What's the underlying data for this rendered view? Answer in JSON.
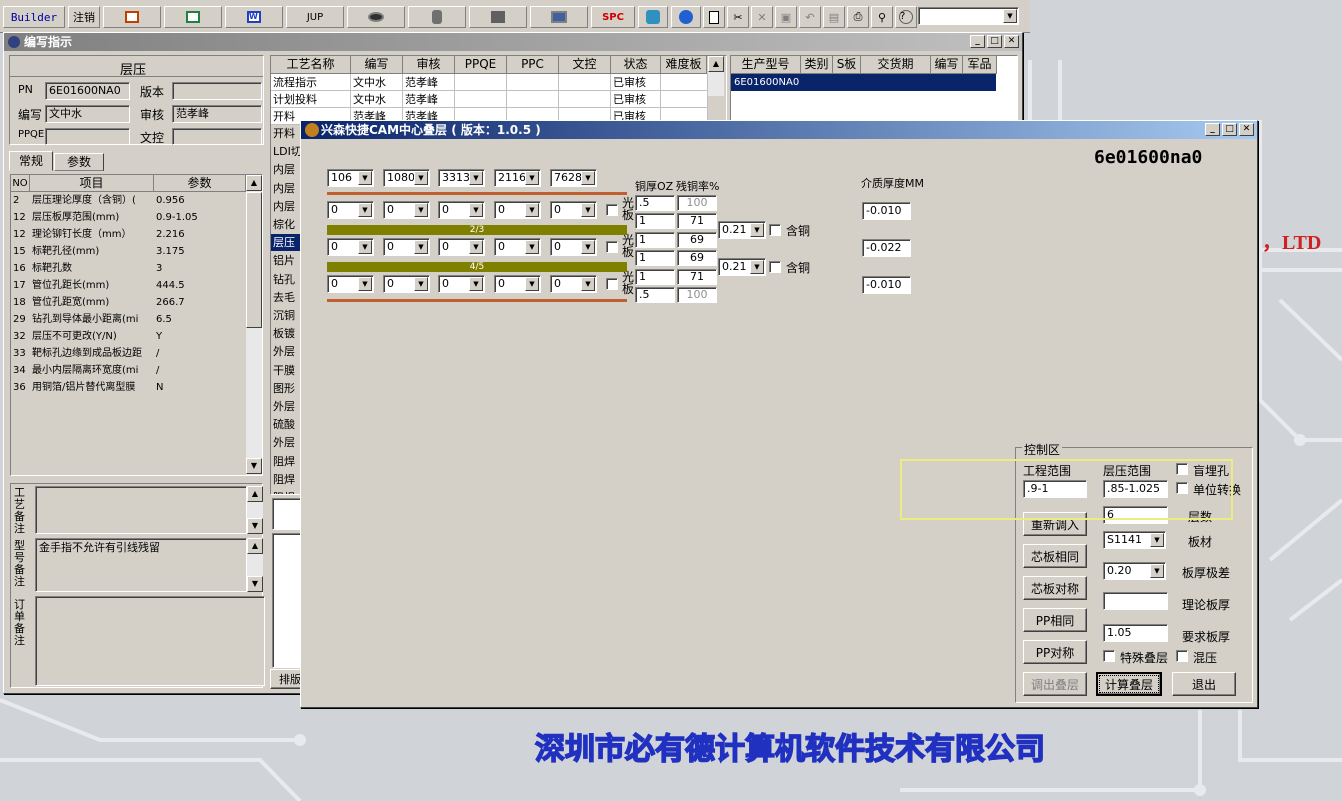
{
  "toolbar": {
    "builder": "Builder",
    "logout": "注销",
    "jup": "JUP",
    "spc": "SPC",
    "icons": [
      "excel-red-icon",
      "excel-green-icon",
      "word-icon",
      "eye-icon",
      "database-icon",
      "tools-icon",
      "monitor-icon",
      "refresh-icon",
      "ie-icon",
      "new-file-icon",
      "cut-icon",
      "close-x-icon",
      "save-icon",
      "undo-icon",
      "preview-icon",
      "print-icon",
      "find-icon",
      "help-icon"
    ]
  },
  "background": {
    "company_cn": "深圳市必有德计算机软件技术有限公司",
    "ltd": "，LTD"
  },
  "main_window": {
    "title": "编写指示",
    "section_title": "层压",
    "pn_label": "PN",
    "pn_value": "6E01600NA0",
    "version_label": "版本",
    "version_value": "",
    "writer_label": "编写",
    "writer_value": "文中水",
    "reviewer_label": "审核",
    "reviewer_value": "范孝峰",
    "ppqe_label": "PPQE",
    "ppqe_value": "",
    "doc_label": "文控",
    "doc_value": "",
    "tabs": [
      "常规",
      "参数"
    ],
    "param_headers": [
      "NO",
      "项目",
      "参数"
    ],
    "params": [
      {
        "no": "2",
        "item": "层压理论厚度（含铜）(",
        "val": "0.956"
      },
      {
        "no": "12",
        "item": "层压板厚范围(mm)",
        "val": "0.9-1.05"
      },
      {
        "no": "12",
        "item": "理论铆钉长度（mm）",
        "val": "2.216"
      },
      {
        "no": "15",
        "item": "标靶孔径(mm)",
        "val": "3.175"
      },
      {
        "no": "16",
        "item": "标靶孔数",
        "val": "3"
      },
      {
        "no": "17",
        "item": "管位孔距长(mm)",
        "val": "444.5"
      },
      {
        "no": "18",
        "item": "管位孔距宽(mm)",
        "val": "266.7"
      },
      {
        "no": "29",
        "item": "钻孔到导体最小距离(mi",
        "val": "6.5"
      },
      {
        "no": "32",
        "item": "层压不可更改(Y/N)",
        "val": "Y"
      },
      {
        "no": "33",
        "item": "靶标孔边缘到成品板边距",
        "val": "/"
      },
      {
        "no": "34",
        "item": "最小内层隔离环宽度(mi",
        "val": "/"
      },
      {
        "no": "36",
        "item": "用铜箔/铝片替代离型膜",
        "val": "N"
      }
    ],
    "note1_label": "工艺备注",
    "note2_label": "型号备注",
    "note2_value": "金手指不允许有引线残留",
    "note3_label": "订单备注",
    "process_headers": [
      "工艺名称",
      "编写",
      "审核",
      "PPQE",
      "PPC",
      "文控",
      "状态",
      "难度板"
    ],
    "process_rows": [
      {
        "name": "流程指示",
        "w": "文中水",
        "r": "范孝峰",
        "s": "已审核"
      },
      {
        "name": "计划投料",
        "w": "文中水",
        "r": "范孝峰",
        "s": "已审核"
      },
      {
        "name": "开料",
        "w": "范孝峰",
        "r": "范孝峰",
        "s": "已审核"
      }
    ],
    "process_names_side": [
      "开料",
      "LDI切",
      "内层",
      "内层",
      "内层",
      "棕化",
      "层压",
      "铝片",
      "钻孔",
      "去毛",
      "沉铜",
      "板镀",
      "外层",
      "干膜",
      "图形",
      "外层",
      "硫酸",
      "外层",
      "阻焊",
      "阻焊",
      "阻焊"
    ],
    "paiban": "排版",
    "model_headers": [
      "生产型号",
      "类别",
      "S板",
      "交货期",
      "编写",
      "军品"
    ],
    "model_row": "6E01600NA0"
  },
  "dialog": {
    "title": "兴森快捷CAM中心叠层 ( 版本：1.0.5 )",
    "model": "6e01600na0",
    "top_combos": [
      "106",
      "1080",
      "3313",
      "2116",
      "7628"
    ],
    "cu_thick_label": "铜厚OZ",
    "residual_label": "残铜率%",
    "dielectric_label": "介质厚度MM",
    "row1": [
      "0",
      "0",
      "0",
      "0",
      "0"
    ],
    "row2": [
      "0",
      "0",
      "0",
      "0",
      "0"
    ],
    "row3": [
      "0",
      "0",
      "0",
      "0",
      "0"
    ],
    "core_labels": [
      "2/3",
      "4/5"
    ],
    "guangban": "光板",
    "cu_values": [
      ".5",
      "1",
      "1",
      "1",
      "1",
      ".5"
    ],
    "res_values": [
      "100",
      "71",
      "69",
      "69",
      "71",
      "100"
    ],
    "core_thick": [
      "0.21",
      "0.21"
    ],
    "hantong": "含铜",
    "dielectrics": [
      "-0.010",
      "-0.022",
      "-0.010"
    ],
    "control_title": "控制区",
    "eng_range_label": "工程范围",
    "eng_range_value": ".9-1",
    "press_range_label": "层压范围",
    "press_range_value": ".85-1.025",
    "blind_label": "盲埋孔",
    "unit_label": "单位转换",
    "layers_label": "层数",
    "layers_value": "6",
    "material_label": "板材",
    "material_value": "S1141",
    "tolerance_label": "板厚极差",
    "tolerance_value": "0.20",
    "theory_label": "理论板厚",
    "theory_value": "",
    "required_label": "要求板厚",
    "required_value": "1.05",
    "special_label": "特殊叠层",
    "mixed_label": "混压",
    "btn_reload": "重新调入",
    "btn_core_same": "芯板相同",
    "btn_core_sym": "芯板对称",
    "btn_pp_same": "PP相同",
    "btn_pp_sym": "PP对称",
    "btn_export": "调出叠层",
    "btn_calc": "计算叠层",
    "btn_exit": "退出"
  }
}
